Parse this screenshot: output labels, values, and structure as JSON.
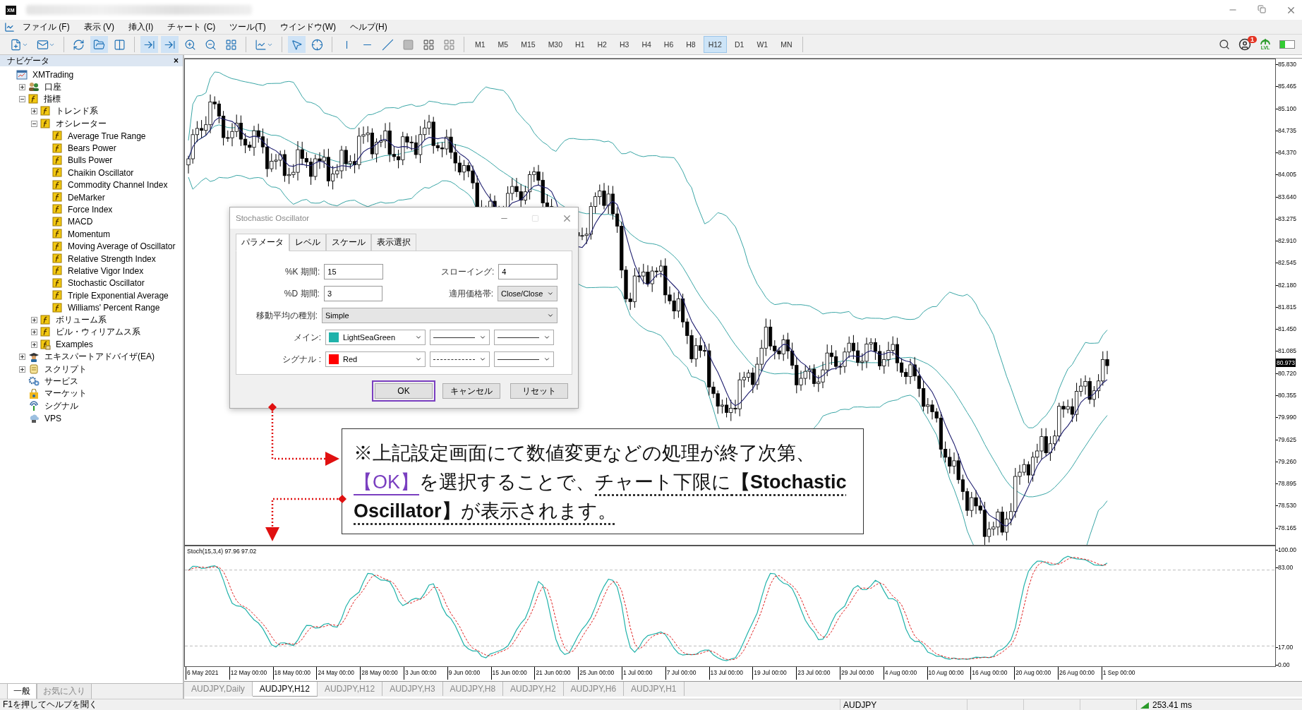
{
  "app_logo": "XM",
  "menu": [
    "ファイル (F)",
    "表示 (V)",
    "挿入(I)",
    "チャート (C)",
    "ツール(T)",
    "ウインドウ(W)",
    "ヘルプ(H)"
  ],
  "toolbar": {
    "timeframes": [
      {
        "label": "M1",
        "selected": false
      },
      {
        "label": "M5",
        "selected": false
      },
      {
        "label": "M15",
        "selected": false
      },
      {
        "label": "M30",
        "selected": false
      },
      {
        "label": "H1",
        "selected": false
      },
      {
        "label": "H2",
        "selected": false
      },
      {
        "label": "H3",
        "selected": false
      },
      {
        "label": "H4",
        "selected": false
      },
      {
        "label": "H6",
        "selected": false
      },
      {
        "label": "H8",
        "selected": false
      },
      {
        "label": "H12",
        "selected": true
      },
      {
        "label": "D1",
        "selected": false
      },
      {
        "label": "W1",
        "selected": false
      },
      {
        "label": "MN",
        "selected": false
      }
    ],
    "notification_count": "1",
    "level_label": "LVL"
  },
  "navigator": {
    "title": "ナビゲータ",
    "close": "×",
    "tree": [
      {
        "label": "XMTrading",
        "kind": "terminal",
        "children": [
          {
            "label": "口座",
            "kind": "accounts",
            "expanded": false
          },
          {
            "label": "指標",
            "kind": "indicator",
            "expanded": true,
            "children": [
              {
                "label": "トレンド系",
                "kind": "indicator",
                "expanded": false
              },
              {
                "label": "オシレーター",
                "kind": "indicator",
                "expanded": true,
                "children": [
                  {
                    "label": "Average True Range",
                    "kind": "indicator"
                  },
                  {
                    "label": "Bears Power",
                    "kind": "indicator"
                  },
                  {
                    "label": "Bulls Power",
                    "kind": "indicator"
                  },
                  {
                    "label": "Chaikin Oscillator",
                    "kind": "indicator"
                  },
                  {
                    "label": "Commodity Channel Index",
                    "kind": "indicator"
                  },
                  {
                    "label": "DeMarker",
                    "kind": "indicator"
                  },
                  {
                    "label": "Force Index",
                    "kind": "indicator"
                  },
                  {
                    "label": "MACD",
                    "kind": "indicator"
                  },
                  {
                    "label": "Momentum",
                    "kind": "indicator"
                  },
                  {
                    "label": "Moving Average of Oscillator",
                    "kind": "indicator"
                  },
                  {
                    "label": "Relative Strength Index",
                    "kind": "indicator"
                  },
                  {
                    "label": "Relative Vigor Index",
                    "kind": "indicator"
                  },
                  {
                    "label": "Stochastic Oscillator",
                    "kind": "indicator"
                  },
                  {
                    "label": "Triple Exponential Average",
                    "kind": "indicator"
                  },
                  {
                    "label": "Williams' Percent Range",
                    "kind": "indicator"
                  }
                ]
              },
              {
                "label": "ボリューム系",
                "kind": "indicator",
                "expanded": false
              },
              {
                "label": "ビル・ウィリアムス系",
                "kind": "indicator",
                "expanded": false
              },
              {
                "label": "Examples",
                "kind": "indicator-folder",
                "expanded": false
              }
            ]
          },
          {
            "label": "エキスパートアドバイザ(EA)",
            "kind": "expert",
            "expanded": false
          },
          {
            "label": "スクリプト",
            "kind": "script",
            "expanded": false
          },
          {
            "label": "サービス",
            "kind": "service"
          },
          {
            "label": "マーケット",
            "kind": "market"
          },
          {
            "label": "シグナル",
            "kind": "signal"
          },
          {
            "label": "VPS",
            "kind": "vps"
          }
        ]
      }
    ],
    "tabs": [
      {
        "label": "一般",
        "selected": true
      },
      {
        "label": "お気に入り",
        "selected": false
      }
    ]
  },
  "chart": {
    "price_axis": [
      "85.830",
      "85.465",
      "85.100",
      "84.735",
      "84.370",
      "84.005",
      "83.640",
      "83.275",
      "82.910",
      "82.545",
      "82.180",
      "81.815",
      "81.450",
      "81.085",
      "80.720",
      "80.355",
      "79.990",
      "79.625",
      "79.260",
      "78.895",
      "78.530",
      "78.165"
    ],
    "current_price": "80.973",
    "indicator_label": "Stoch(15,3,4) 97.96 97.02",
    "indicator_axis": [
      "100.00",
      "83.00",
      "17.00",
      "0.00"
    ],
    "date_axis": [
      "6 May 2021",
      "12 May 00:00",
      "18 May 00:00",
      "24 May 00:00",
      "28 May 00:00",
      "3 Jun 00:00",
      "9 Jun 00:00",
      "15 Jun 00:00",
      "21 Jun 00:00",
      "25 Jun 00:00",
      "1 Jul 00:00",
      "7 Jul 00:00",
      "13 Jul 00:00",
      "19 Jul 00:00",
      "23 Jul 00:00",
      "29 Jul 00:00",
      "4 Aug 00:00",
      "10 Aug 00:00",
      "16 Aug 00:00",
      "20 Aug 00:00",
      "26 Aug 00:00",
      "1 Sep 00:00"
    ]
  },
  "chart_tabs": [
    {
      "label": "AUDJPY,Daily",
      "selected": false
    },
    {
      "label": "AUDJPY,H12",
      "selected": true
    },
    {
      "label": "AUDJPY,H12",
      "selected": false
    },
    {
      "label": "AUDJPY,H3",
      "selected": false
    },
    {
      "label": "AUDJPY,H8",
      "selected": false
    },
    {
      "label": "AUDJPY,H2",
      "selected": false
    },
    {
      "label": "AUDJPY,H6",
      "selected": false
    },
    {
      "label": "AUDJPY,H1",
      "selected": false
    }
  ],
  "status": {
    "help": "F1を押してヘルプを聞く",
    "symbol": "AUDJPY",
    "ping": "253.41 ms"
  },
  "dialog": {
    "title": "Stochastic Oscillator",
    "maximize_disabled": true,
    "tabs": [
      {
        "label": "パラメータ",
        "selected": true
      },
      {
        "label": "レベル",
        "selected": false
      },
      {
        "label": "スケール",
        "selected": false
      },
      {
        "label": "表示選択",
        "selected": false
      }
    ],
    "k_period": {
      "label": "%K 期間:",
      "value": "15"
    },
    "slowing": {
      "label": "スローイング:",
      "value": "4"
    },
    "d_period": {
      "label": "%D 期間:",
      "value": "3"
    },
    "price_field": {
      "label": "適用価格帯:",
      "value": "Close/Close"
    },
    "ma_method": {
      "label": "移動平均の種別:",
      "value": "Simple"
    },
    "lines": [
      {
        "label": "メイン:",
        "color": "#20b2aa",
        "color_name": "LightSeaGreen"
      },
      {
        "label": "シグナル :",
        "color": "#ff0000",
        "color_name": "Red"
      }
    ],
    "buttons": [
      {
        "label": "OK",
        "highlighted": true
      },
      {
        "label": "キャンセル",
        "highlighted": false
      },
      {
        "label": "リセット",
        "highlighted": false
      }
    ]
  },
  "callout": {
    "segments": [
      {
        "text": "※上記設定画面にて数値変更などの処理が終了次第、",
        "kind": "plain"
      },
      {
        "text": "【OK】",
        "kind": "accent"
      },
      {
        "text": "を選択することで、",
        "kind": "plain"
      },
      {
        "text": "チャート下限に",
        "kind": "underlined"
      },
      {
        "text": "【Stochastic Oscillator】",
        "kind": "bold"
      },
      {
        "text": "が表示されます。",
        "kind": "underlined"
      }
    ]
  }
}
